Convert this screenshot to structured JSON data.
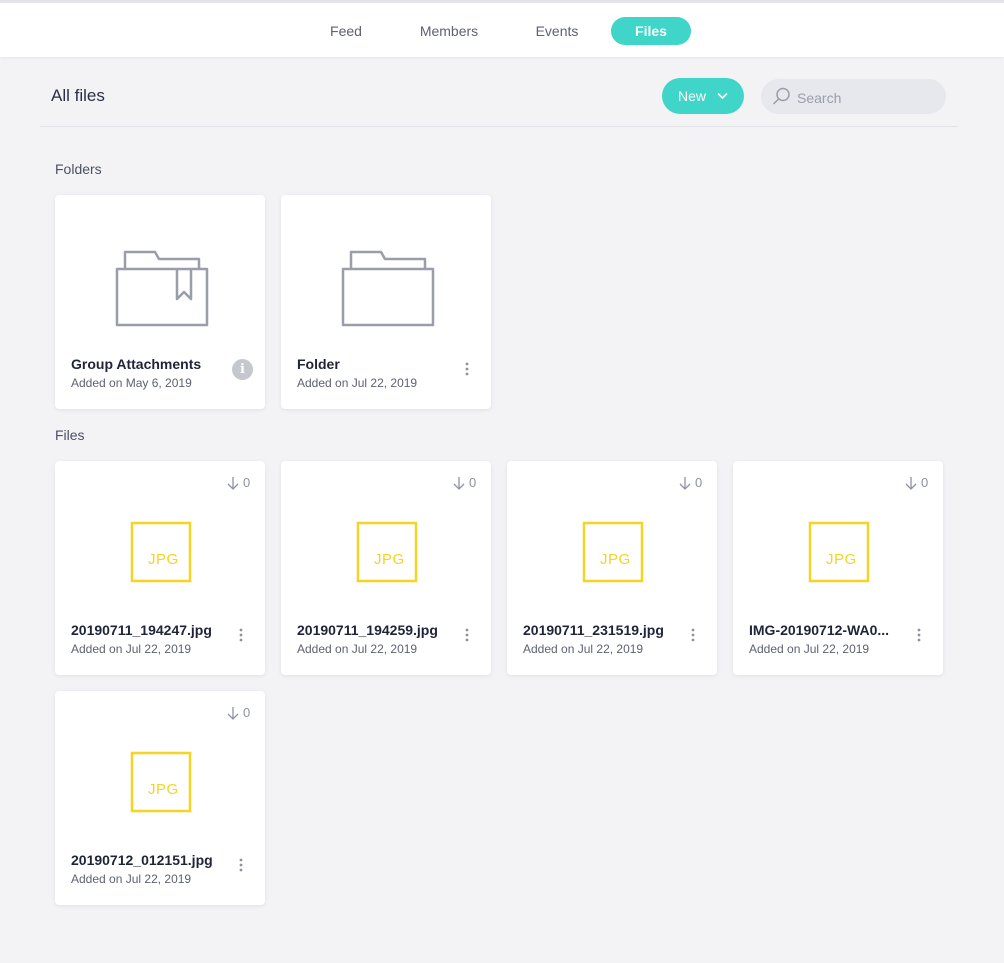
{
  "nav": {
    "tabs": [
      {
        "label": "Feed",
        "active": false
      },
      {
        "label": "Members",
        "active": false
      },
      {
        "label": "Events",
        "active": false
      },
      {
        "label": "Files",
        "active": true
      }
    ]
  },
  "header": {
    "title": "All files",
    "new_label": "New",
    "search_placeholder": "Search"
  },
  "sections": {
    "folders_label": "Folders",
    "files_label": "Files"
  },
  "folders": [
    {
      "name": "Group Attachments",
      "date": "Added on May 6, 2019",
      "icon": "bookmark-folder-icon",
      "action": "info-icon"
    },
    {
      "name": "Folder",
      "date": "Added on Jul 22, 2019",
      "icon": "folder-icon",
      "action": "more-icon"
    }
  ],
  "files": [
    {
      "name": "20190711_194247.jpg",
      "date": "Added on Jul 22, 2019",
      "downloads": "0",
      "type": "JPG"
    },
    {
      "name": "20190711_194259.jpg",
      "date": "Added on Jul 22, 2019",
      "downloads": "0",
      "type": "JPG"
    },
    {
      "name": "20190711_231519.jpg",
      "date": "Added on Jul 22, 2019",
      "downloads": "0",
      "type": "JPG"
    },
    {
      "name": "IMG-20190712-WA0...",
      "date": "Added on Jul 22, 2019",
      "downloads": "0",
      "type": "JPG"
    },
    {
      "name": "20190712_012151.jpg",
      "date": "Added on Jul 22, 2019",
      "downloads": "0",
      "type": "JPG"
    }
  ],
  "colors": {
    "accent": "#3fd5c9",
    "jpg_icon": "#f5d423",
    "background": "#f3f3f6"
  }
}
